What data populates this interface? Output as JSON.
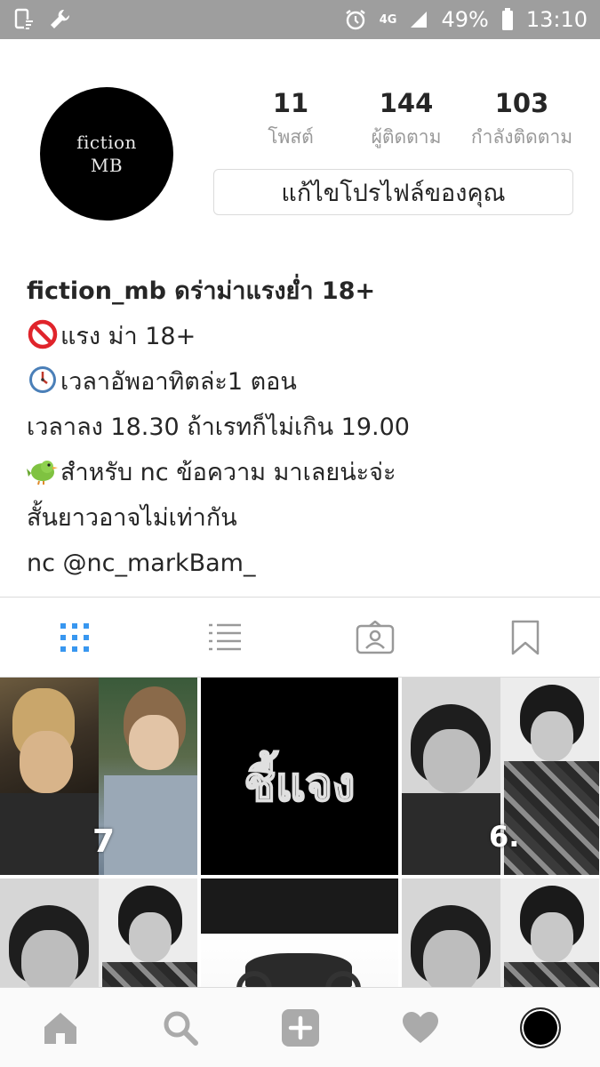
{
  "status_bar": {
    "network": "4G",
    "battery": "49%",
    "time": "13:10",
    "icons": [
      "screenshot-icon",
      "wrench-icon",
      "alarm-icon",
      "signal-icon",
      "battery-icon"
    ]
  },
  "profile": {
    "avatar_line1": "fiction",
    "avatar_line2": "MB",
    "stats": [
      {
        "value": "11",
        "label": "โพสต์"
      },
      {
        "value": "144",
        "label": "ผู้ติดตาม"
      },
      {
        "value": "103",
        "label": "กำลังติดตาม"
      }
    ],
    "edit_button": "แก้ไขโปรไฟล์ของคุณ"
  },
  "bio": {
    "name_line": "fiction_mb ดร่าม่าแรงย่ำ 18+",
    "line2": "แรง ม่า 18+",
    "line3": "เวลาอัพอาทิตล่ะ1 ตอน",
    "line4": "เวลาลง 18.30 ถ้าเรทก็ไม่เกิน 19.00",
    "line5": "สำหรับ nc ข้อความ มาเลยน่ะจ่ะ",
    "line6": "สั้นยาวอาจไม่เท่ากัน",
    "line7": "nc @nc_markBam_"
  },
  "tabs": [
    "grid-view-tab",
    "list-view-tab",
    "tagged-tab",
    "saved-tab"
  ],
  "grid": {
    "post1_number": "7",
    "post2_title": "ชี้แจง",
    "post3_number": "6."
  },
  "colors": {
    "status_bar": "#9e9e9e",
    "active_tab": "#3897f0",
    "inactive_icon": "#999999"
  }
}
